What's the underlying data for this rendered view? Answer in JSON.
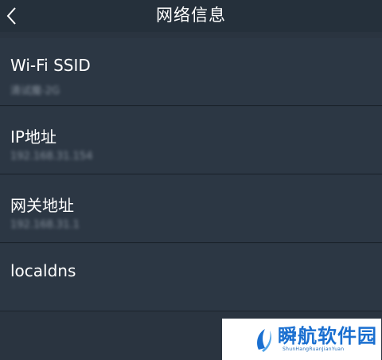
{
  "header": {
    "title": "网络信息",
    "back_icon": "chevron-left-icon"
  },
  "rows": [
    {
      "label": "Wi-Fi SSID",
      "value": "清试魔-2G"
    },
    {
      "label": "IP地址",
      "value": "192.168.31.154"
    },
    {
      "label": "网关地址",
      "value": "192.168.31.1"
    },
    {
      "label": "localdns",
      "value": ""
    }
  ],
  "watermark": {
    "name": "瞬航软件园",
    "pinyin": "ShunHangRuanJianYuan"
  },
  "colors": {
    "background": "#2a3440",
    "navbar": "#25303b",
    "row": "#2c3744",
    "divider": "#1b232c",
    "watermark_text": "#1a6fd0"
  }
}
